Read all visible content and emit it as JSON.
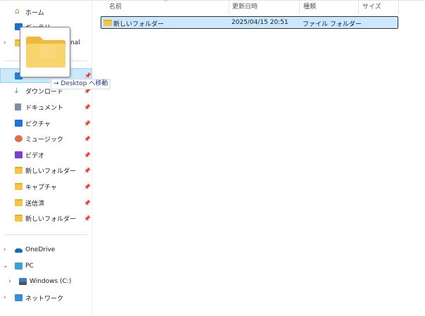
{
  "sidebar": {
    "quick": [
      {
        "label": "ホーム",
        "icon": "home-icon"
      },
      {
        "label": "ギャラリー",
        "icon": "gallery-icon"
      },
      {
        "label": "nal",
        "icon": "folder-icon"
      }
    ],
    "pinned": [
      {
        "label": "",
        "icon": "desktop-icon",
        "selected": true
      },
      {
        "label": "ダウンロード",
        "icon": "download-icon"
      },
      {
        "label": "ドキュメント",
        "icon": "document-icon"
      },
      {
        "label": "ピクチャ",
        "icon": "pictures-icon"
      },
      {
        "label": "ミュージック",
        "icon": "music-icon"
      },
      {
        "label": "ビデオ",
        "icon": "video-icon"
      },
      {
        "label": "新しいフォルダー",
        "icon": "folder-icon"
      },
      {
        "label": "キャプチャ",
        "icon": "folder-icon"
      },
      {
        "label": "送信済",
        "icon": "folder-icon"
      },
      {
        "label": "新しいフォルダー",
        "icon": "folder-icon"
      }
    ],
    "tree": [
      {
        "label": "OneDrive",
        "icon": "onedrive-icon"
      },
      {
        "label": "PC",
        "icon": "pc-icon"
      },
      {
        "label": "Windows (C:)",
        "icon": "drive-icon"
      },
      {
        "label": "ネットワーク",
        "icon": "network-icon"
      }
    ]
  },
  "drag": {
    "tooltip": "→ Desktop へ移動"
  },
  "columns": {
    "name": "名前",
    "modified": "更新日時",
    "type": "種類",
    "size": "サイズ"
  },
  "files": [
    {
      "name": "新しいフォルダー",
      "modified": "2025/04/15 20:51",
      "type": "ファイル フォルダー",
      "size": ""
    }
  ],
  "colors": {
    "selection": "#cce8ff",
    "folder": "#f3c548",
    "accent": "#0078d4"
  }
}
